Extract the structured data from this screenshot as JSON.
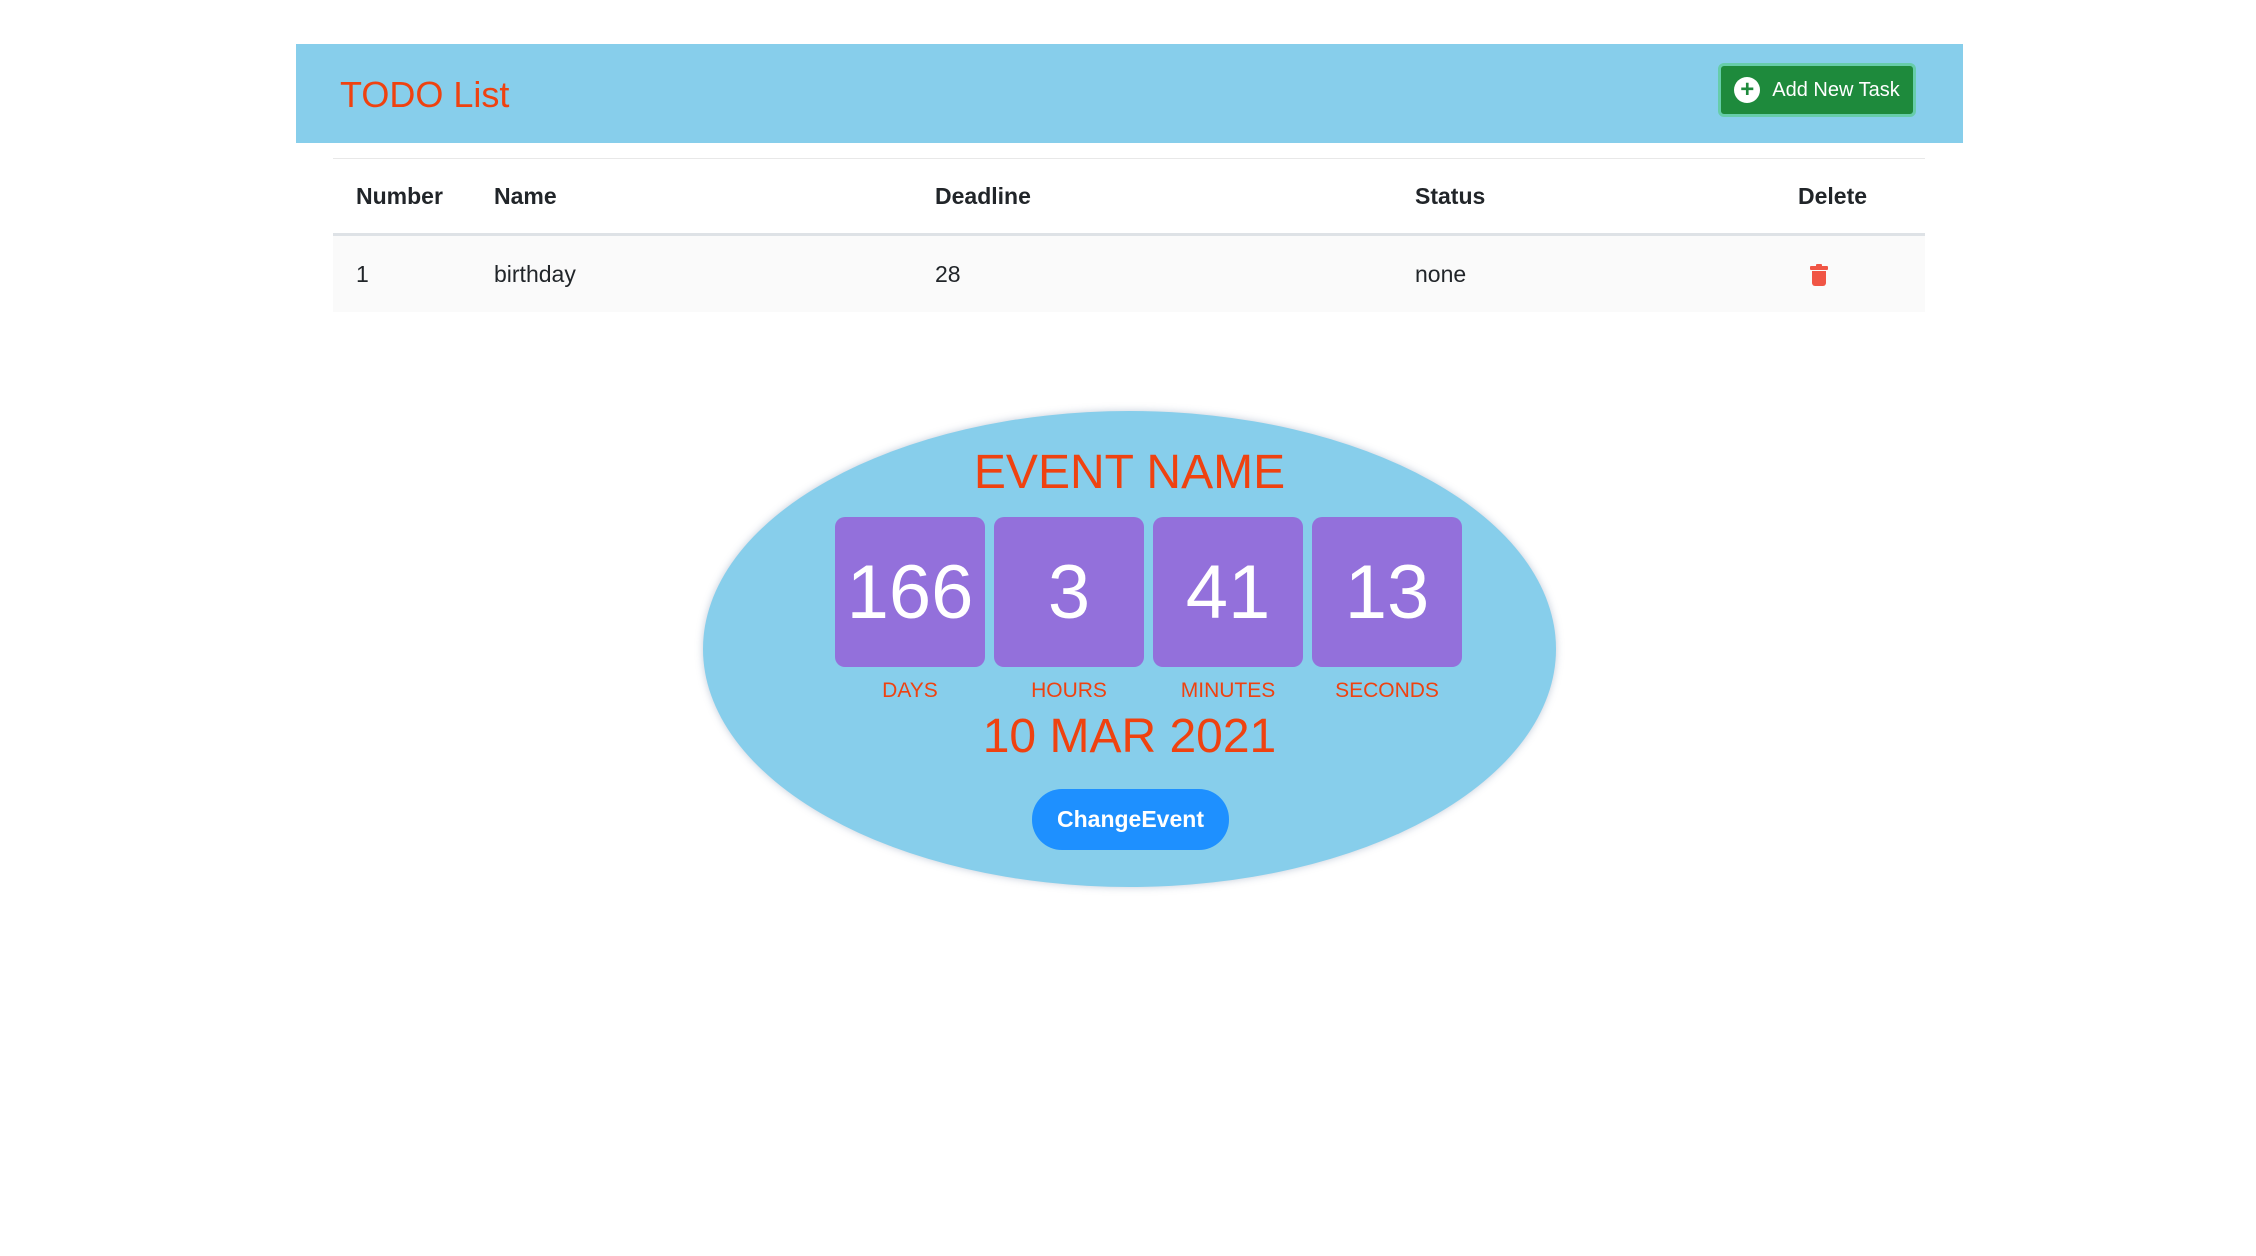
{
  "header": {
    "title": "TODO List",
    "add_button_label": "Add New Task"
  },
  "table": {
    "columns": [
      "Number",
      "Name",
      "Deadline",
      "Status",
      "Delete"
    ],
    "rows": [
      {
        "number": "1",
        "name": "birthday",
        "deadline": "28",
        "status": "none"
      }
    ]
  },
  "event": {
    "name": "EVENT NAME",
    "countdown": [
      {
        "value": "166",
        "label": "DAYS"
      },
      {
        "value": "3",
        "label": "HOURS"
      },
      {
        "value": "41",
        "label": "MINUTES"
      },
      {
        "value": "13",
        "label": "SECONDS"
      }
    ],
    "date": "10 MAR 2021",
    "change_button_label": "ChangeEvent"
  },
  "colors": {
    "header_bg": "#87ceeb",
    "accent_text": "#ef4210",
    "add_button_bg": "#1e8a3c",
    "tile_bg": "#9370db",
    "change_button_bg": "#1e90ff",
    "delete_icon": "#f05545"
  },
  "icons": {
    "add": "plus-circle-icon",
    "delete": "trash-icon"
  }
}
